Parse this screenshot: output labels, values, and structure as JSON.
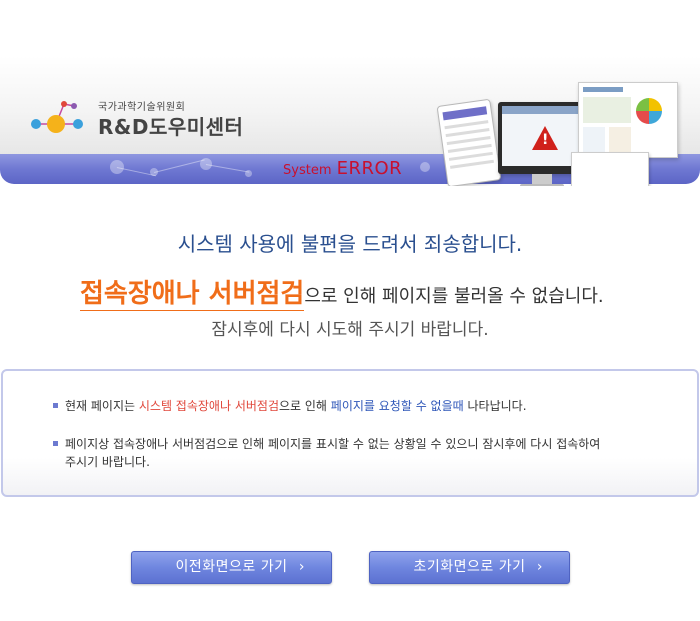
{
  "header": {
    "org_subtitle": "국가과학기술위원회",
    "org_title": "R&D도우미센터",
    "system_label": "System",
    "error_label": "ERROR"
  },
  "message": {
    "apology": "시스템 사용에 불편을 드려서 죄송합니다.",
    "cause_highlight": "접속장애나 서버점검",
    "cause_rest": "으로 인해 페이지를 불러올 수 없습니다.",
    "retry": "잠시후에 다시 시도해 주시기 바랍니다."
  },
  "info": {
    "item1": {
      "prefix": "현재 페이지는 ",
      "red": "시스템 접속장애나 서버점검",
      "mid": "으로 인해 ",
      "blue": "페이지를 요청할 수 없을때",
      "suffix": " 나타납니다."
    },
    "item2": {
      "line1": "페이지상 접속장애나 서버점검으로 인해 페이지를 표시할 수 없는 상황일 수 있으니 잠시후에 다시 접속하여",
      "line2": "주시기 바랍니다."
    }
  },
  "buttons": {
    "prev_label": "이전화면으로 가기",
    "home_label": "초기화면으로 가기",
    "chevron": "›"
  },
  "colors": {
    "accent_blue": "#6f86df",
    "highlight_orange": "#f06d19",
    "error_red": "#c8102e",
    "text_blue": "#2e56b8",
    "text_red": "#e0473b"
  }
}
